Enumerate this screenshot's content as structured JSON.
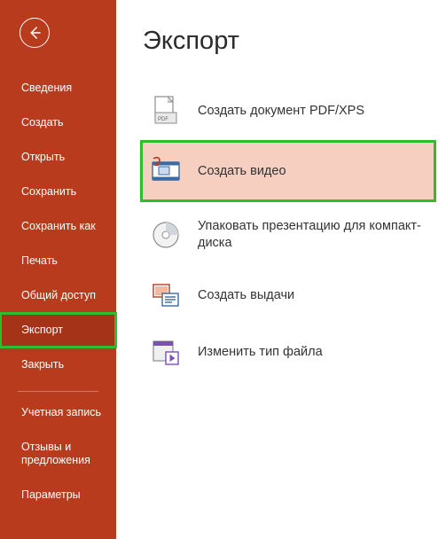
{
  "sidebar": {
    "items": [
      {
        "label": "Сведения"
      },
      {
        "label": "Создать"
      },
      {
        "label": "Открыть"
      },
      {
        "label": "Сохранить"
      },
      {
        "label": "Сохранить как"
      },
      {
        "label": "Печать"
      },
      {
        "label": "Общий доступ"
      },
      {
        "label": "Экспорт"
      },
      {
        "label": "Закрыть"
      }
    ],
    "footer": [
      {
        "label": "Учетная запись"
      },
      {
        "label": "Отзывы и предложения"
      },
      {
        "label": "Параметры"
      }
    ]
  },
  "page": {
    "title": "Экспорт",
    "options": [
      {
        "label": "Создать документ PDF/XPS"
      },
      {
        "label": "Создать видео"
      },
      {
        "label": "Упаковать презентацию для компакт-диска"
      },
      {
        "label": "Создать выдачи"
      },
      {
        "label": "Изменить тип файла"
      }
    ]
  }
}
